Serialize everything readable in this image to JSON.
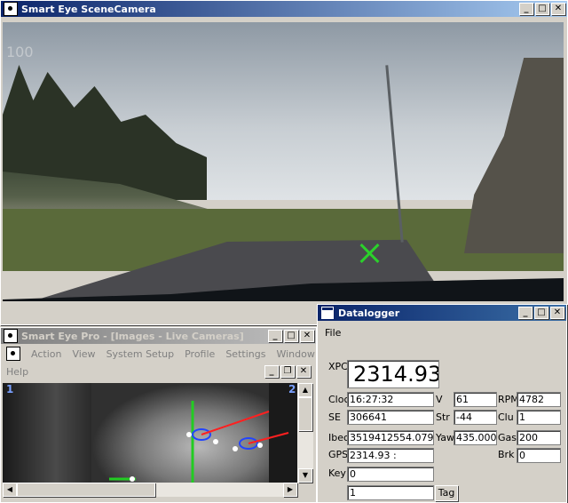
{
  "scene_window": {
    "title": "Smart Eye SceneCamera",
    "buttons": [
      "_",
      "□",
      "✕"
    ],
    "overlay_text": "100"
  },
  "pro_window": {
    "title": "Smart Eye Pro - [Images - Live Cameras]",
    "buttons": [
      "_",
      "□",
      "✕"
    ],
    "menu": [
      "Action",
      "View",
      "System Setup",
      "Profile",
      "Settings",
      "Window"
    ],
    "menu2": [
      "Help"
    ],
    "child_buttons": [
      "_",
      "❐",
      "✕"
    ],
    "camera_labels": [
      "1",
      "2"
    ]
  },
  "datalogger": {
    "title": "Datalogger",
    "buttons": [
      "_",
      "□",
      "✕"
    ],
    "menu_file": "File",
    "xpc_label": "XPC",
    "xpc_value": "2314.93",
    "rows": {
      "cloc_label": "Cloc",
      "cloc_value": "16:27:32",
      "se_label": "SE",
      "se_value": "306641",
      "ibec_label": "Ibec",
      "ibec_value": "3519412554.07914",
      "gps_label": "GPS",
      "gps_value": "2314.93 :",
      "key_label": "Key",
      "key_value": "0",
      "tag_value": "1",
      "v_label": "V",
      "v_value": "61",
      "str_label": "Str",
      "str_value": "-44",
      "yaw_label": "Yaw",
      "yaw_value": "435.000",
      "rpm_label": "RPM",
      "rpm_value": "4782",
      "clu_label": "Clu",
      "clu_value": "1",
      "gas_label": "Gas",
      "gas_value": "200",
      "brk_label": "Brk",
      "brk_value": "0"
    },
    "tag_button": "Tag"
  }
}
